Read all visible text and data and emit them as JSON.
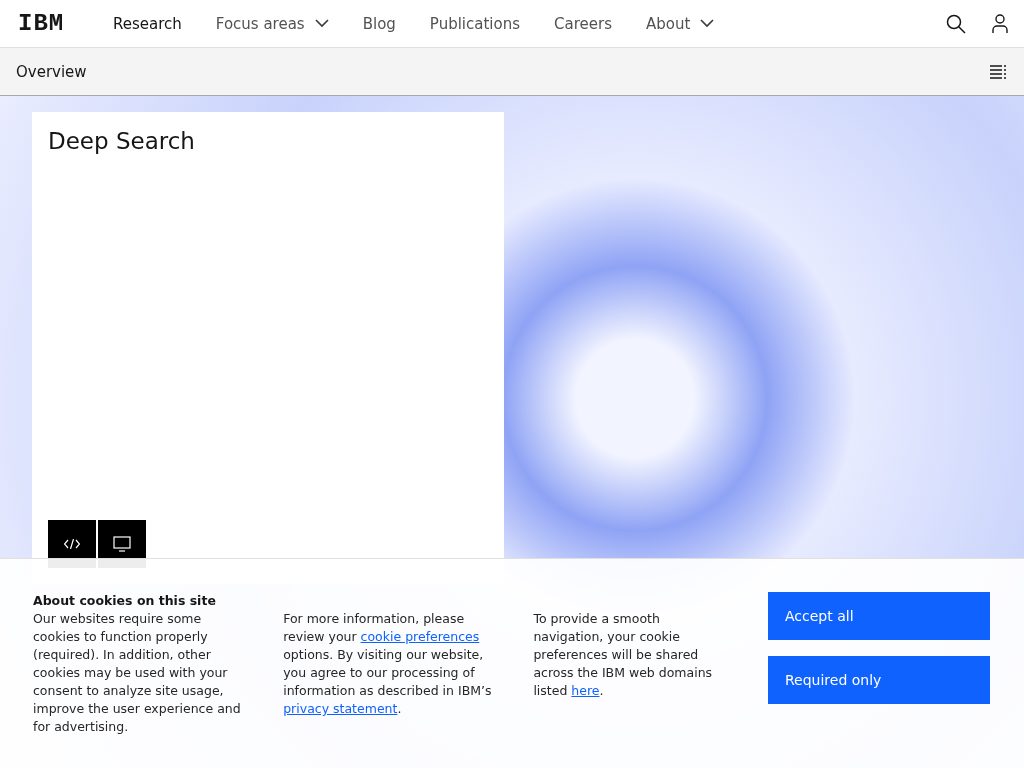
{
  "header": {
    "logo": "IBM",
    "nav": [
      {
        "label": "Research",
        "selected": true,
        "dropdown": false
      },
      {
        "label": "Focus areas",
        "selected": false,
        "dropdown": true
      },
      {
        "label": "Blog",
        "selected": false,
        "dropdown": false
      },
      {
        "label": "Publications",
        "selected": false,
        "dropdown": false
      },
      {
        "label": "Careers",
        "selected": false,
        "dropdown": false
      },
      {
        "label": "About",
        "selected": false,
        "dropdown": true
      }
    ]
  },
  "subnav": {
    "title": "Overview"
  },
  "card": {
    "title": "Deep Search"
  },
  "cookie_banner": {
    "title": "About cookies on this site",
    "paragraph_1": "Our websites require some cookies to function properly (required). In addition, other cookies may be used with your consent to analyze site usage, improve the user experience and for advertising.",
    "paragraph_2": {
      "before": "For more information, please review your",
      "link_1": "cookie preferences",
      "middle": " options. By visiting our website, you agree to our processing of information as described in IBM’s",
      "link_2": "privacy statement",
      "after": "."
    },
    "paragraph_3": {
      "before": "To provide a smooth navigation, your cookie preferences will be shared across the IBM web domains listed",
      "link": "here",
      "after": "."
    },
    "buttons": [
      "Accept all",
      "Required only"
    ]
  }
}
